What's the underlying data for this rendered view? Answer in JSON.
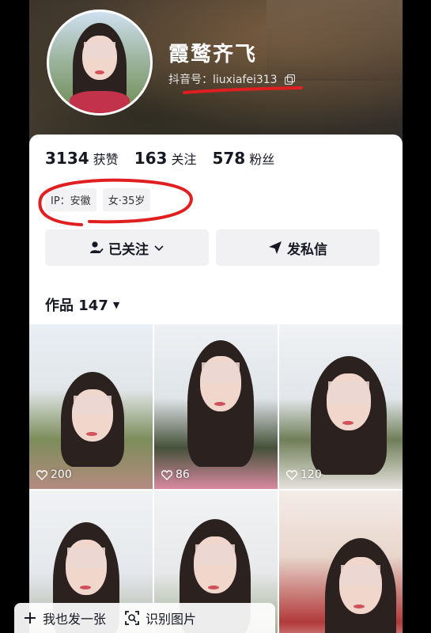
{
  "profile": {
    "nickname": "霞鹜齐飞",
    "douyin_id": "抖音号：liuxiafei313"
  },
  "stats": [
    {
      "value": "3134",
      "label": "获赞"
    },
    {
      "value": "163",
      "label": "关注"
    },
    {
      "value": "578",
      "label": "粉丝"
    }
  ],
  "tags": [
    "IP：安徽",
    "女·35岁"
  ],
  "actions": {
    "follow_label": "已关注",
    "message_label": "发私信"
  },
  "works": {
    "label": "作品 147"
  },
  "videos": [
    {
      "likes": "200"
    },
    {
      "likes": "86"
    },
    {
      "likes": "120"
    },
    {
      "likes": ""
    },
    {
      "likes": ""
    },
    {
      "likes": ""
    }
  ],
  "bottom_bar": {
    "post_label": "我也发一张",
    "identify_label": "识别图片"
  },
  "colors": {
    "annotation_red": "#e02020",
    "text_primary": "#161823"
  },
  "icons": [
    "copy-icon",
    "user-check-icon",
    "chevron-down-icon",
    "send-icon",
    "heart-icon",
    "plus-icon",
    "scan-icon"
  ]
}
